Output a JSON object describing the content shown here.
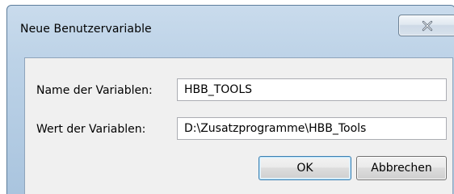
{
  "dialog": {
    "title": "Neue Benutzervariable",
    "close_icon": "close-icon"
  },
  "form": {
    "name_label": "Name der Variablen:",
    "name_value": "HBB_TOOLS",
    "value_label": "Wert der Variablen:",
    "value_value": "D:\\Zusatzprogramme\\HBB_Tools"
  },
  "buttons": {
    "ok_label": "OK",
    "cancel_label": "Abbrechen"
  }
}
